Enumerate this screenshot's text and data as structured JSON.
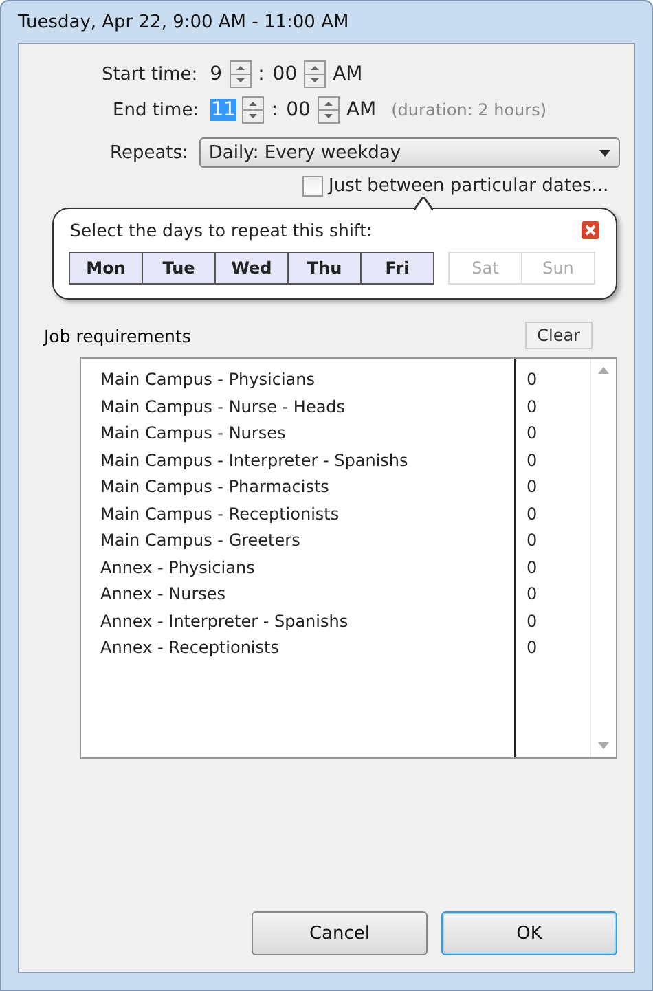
{
  "window": {
    "title": "Tuesday, Apr 22, 9:00 AM - 11:00 AM"
  },
  "start_time": {
    "label": "Start time:",
    "hour": "9",
    "separator": ":",
    "minute": "00",
    "ampm": "AM",
    "hour_selected": false
  },
  "end_time": {
    "label": "End time:",
    "hour": "11",
    "separator": ":",
    "minute": "00",
    "ampm": "AM",
    "hour_selected": true,
    "duration": "(duration: 2 hours)"
  },
  "repeats": {
    "label": "Repeats:",
    "value": "Daily: Every weekday"
  },
  "date_range": {
    "label": "Just between particular dates...",
    "checked": false
  },
  "days_popup": {
    "title": "Select the days to repeat this shift:",
    "days": [
      {
        "label": "Mon",
        "selected": true
      },
      {
        "label": "Tue",
        "selected": true
      },
      {
        "label": "Wed",
        "selected": true
      },
      {
        "label": "Thu",
        "selected": true
      },
      {
        "label": "Fri",
        "selected": true
      },
      {
        "label": "Sat",
        "selected": false
      },
      {
        "label": "Sun",
        "selected": false
      }
    ]
  },
  "job_requirements": {
    "title": "Job requirements",
    "clear_button": "Clear",
    "rows": [
      {
        "name": "Main Campus - Physicians",
        "count": "0"
      },
      {
        "name": "Main Campus - Nurse - Heads",
        "count": "0"
      },
      {
        "name": "Main Campus - Nurses",
        "count": "0"
      },
      {
        "name": "Main Campus - Interpreter - Spanishs",
        "count": "0"
      },
      {
        "name": "Main Campus - Pharmacists",
        "count": "0"
      },
      {
        "name": "Main Campus - Receptionists",
        "count": "0"
      },
      {
        "name": "Main Campus - Greeters",
        "count": "0"
      },
      {
        "name": "Annex - Physicians",
        "count": "0"
      },
      {
        "name": "Annex - Nurses",
        "count": "0"
      },
      {
        "name": "Annex - Interpreter - Spanishs",
        "count": "0"
      },
      {
        "name": "Annex - Receptionists",
        "count": "0"
      }
    ]
  },
  "buttons": [
    {
      "label": "Cancel",
      "default": false
    },
    {
      "label": "OK",
      "default": true
    }
  ]
}
